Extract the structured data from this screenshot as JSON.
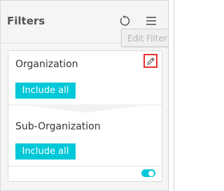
{
  "header": {
    "title": "Filters",
    "tooltip": "Edit Filter"
  },
  "icons": {
    "reset": "refresh-icon",
    "menu": "hamburger-menu-icon",
    "edit": "pencil-icon"
  },
  "filters": [
    {
      "label": "Organization",
      "button_label": "Include all"
    },
    {
      "label": "Sub-Organization",
      "button_label": "Include all"
    }
  ],
  "toggle": {
    "on": true
  },
  "colors": {
    "accent": "#00c8d8",
    "highlight_border": "#e53333",
    "panel_bg": "#f5f5f5"
  }
}
